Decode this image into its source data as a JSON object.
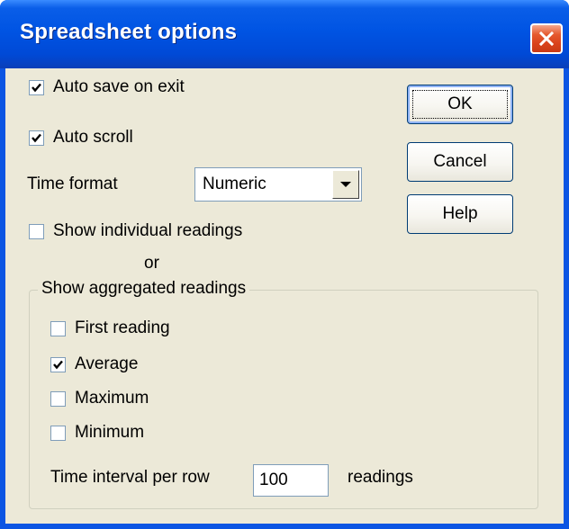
{
  "window": {
    "title": "Spreadsheet options"
  },
  "options": {
    "auto_save_label": "Auto save on exit",
    "auto_save_checked": true,
    "auto_scroll_label": "Auto scroll",
    "auto_scroll_checked": true,
    "time_format_label": "Time format",
    "time_format_value": "Numeric",
    "show_individual_label": "Show individual readings",
    "show_individual_checked": false,
    "or_label": "or"
  },
  "aggregated": {
    "group_label": "Show aggregated readings",
    "items": [
      {
        "label": "First reading",
        "checked": false
      },
      {
        "label": "Average",
        "checked": true
      },
      {
        "label": "Maximum",
        "checked": false
      },
      {
        "label": "Minimum",
        "checked": false
      }
    ],
    "interval_label": "Time interval per row",
    "interval_value": "100",
    "interval_unit": "readings"
  },
  "buttons": {
    "ok": "OK",
    "cancel": "Cancel",
    "help": "Help"
  },
  "icons": {
    "close": "close-icon",
    "dropdown": "chevron-down-icon",
    "check": "check-icon"
  },
  "colors": {
    "titlebar": "#0054e3",
    "client": "#ece9d8",
    "close": "#d9421b"
  }
}
